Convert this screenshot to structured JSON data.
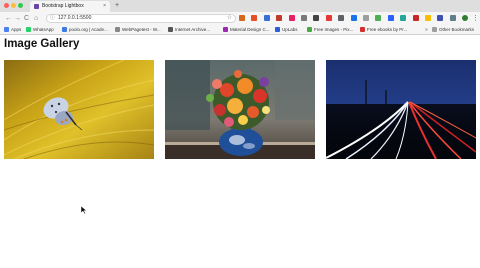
{
  "browser": {
    "tab_title": "Bootstrap Lightbox",
    "tab_close": "×",
    "new_tab": "+",
    "url": "127.0.0.1:5500",
    "nav_back": "←",
    "nav_forward": "→",
    "nav_reload": "C",
    "nav_home": "⌂",
    "star": "☆",
    "menu": "⋮",
    "extension_colors": [
      "#d2691e",
      "#e44d26",
      "#3b6fd8",
      "#c0392b",
      "#e91e63",
      "#7a7a7a",
      "#444444",
      "#e53935",
      "#5f6368",
      "#1a73e8",
      "#9e9e9e",
      "#4caf50",
      "#2962ff",
      "#26a69a",
      "#c62828",
      "#fbbc04",
      "#3f51b5",
      "#607d8b",
      "#2e7d32"
    ]
  },
  "bookmarks": {
    "items": [
      {
        "label": "Apps",
        "color": "#4a80f5"
      },
      {
        "label": "WhatsApp",
        "color": "#25d366"
      },
      {
        "label": "poolo.org | Acade...",
        "color": "#3d7be0"
      },
      {
        "label": "WebPagetest - W...",
        "color": "#888888"
      },
      {
        "label": "Internet Archive...",
        "color": "#555555"
      },
      {
        "label": "Material Design C...",
        "color": "#9c27b0"
      },
      {
        "label": "UpLabs",
        "color": "#2b5bd7"
      },
      {
        "label": "Free Images - Pix...",
        "color": "#48a843"
      },
      {
        "label": "Free ebooks by Pr...",
        "color": "#d32f2f"
      }
    ],
    "more": "»",
    "other": {
      "label": "Other Bookmarks",
      "color": "#9e9e9e"
    }
  },
  "page": {
    "title": "Image Gallery",
    "images": [
      {
        "subject": "butterfly on yellow grass"
      },
      {
        "subject": "flower bouquet in blue vase"
      },
      {
        "subject": "night highway light trails"
      }
    ]
  }
}
